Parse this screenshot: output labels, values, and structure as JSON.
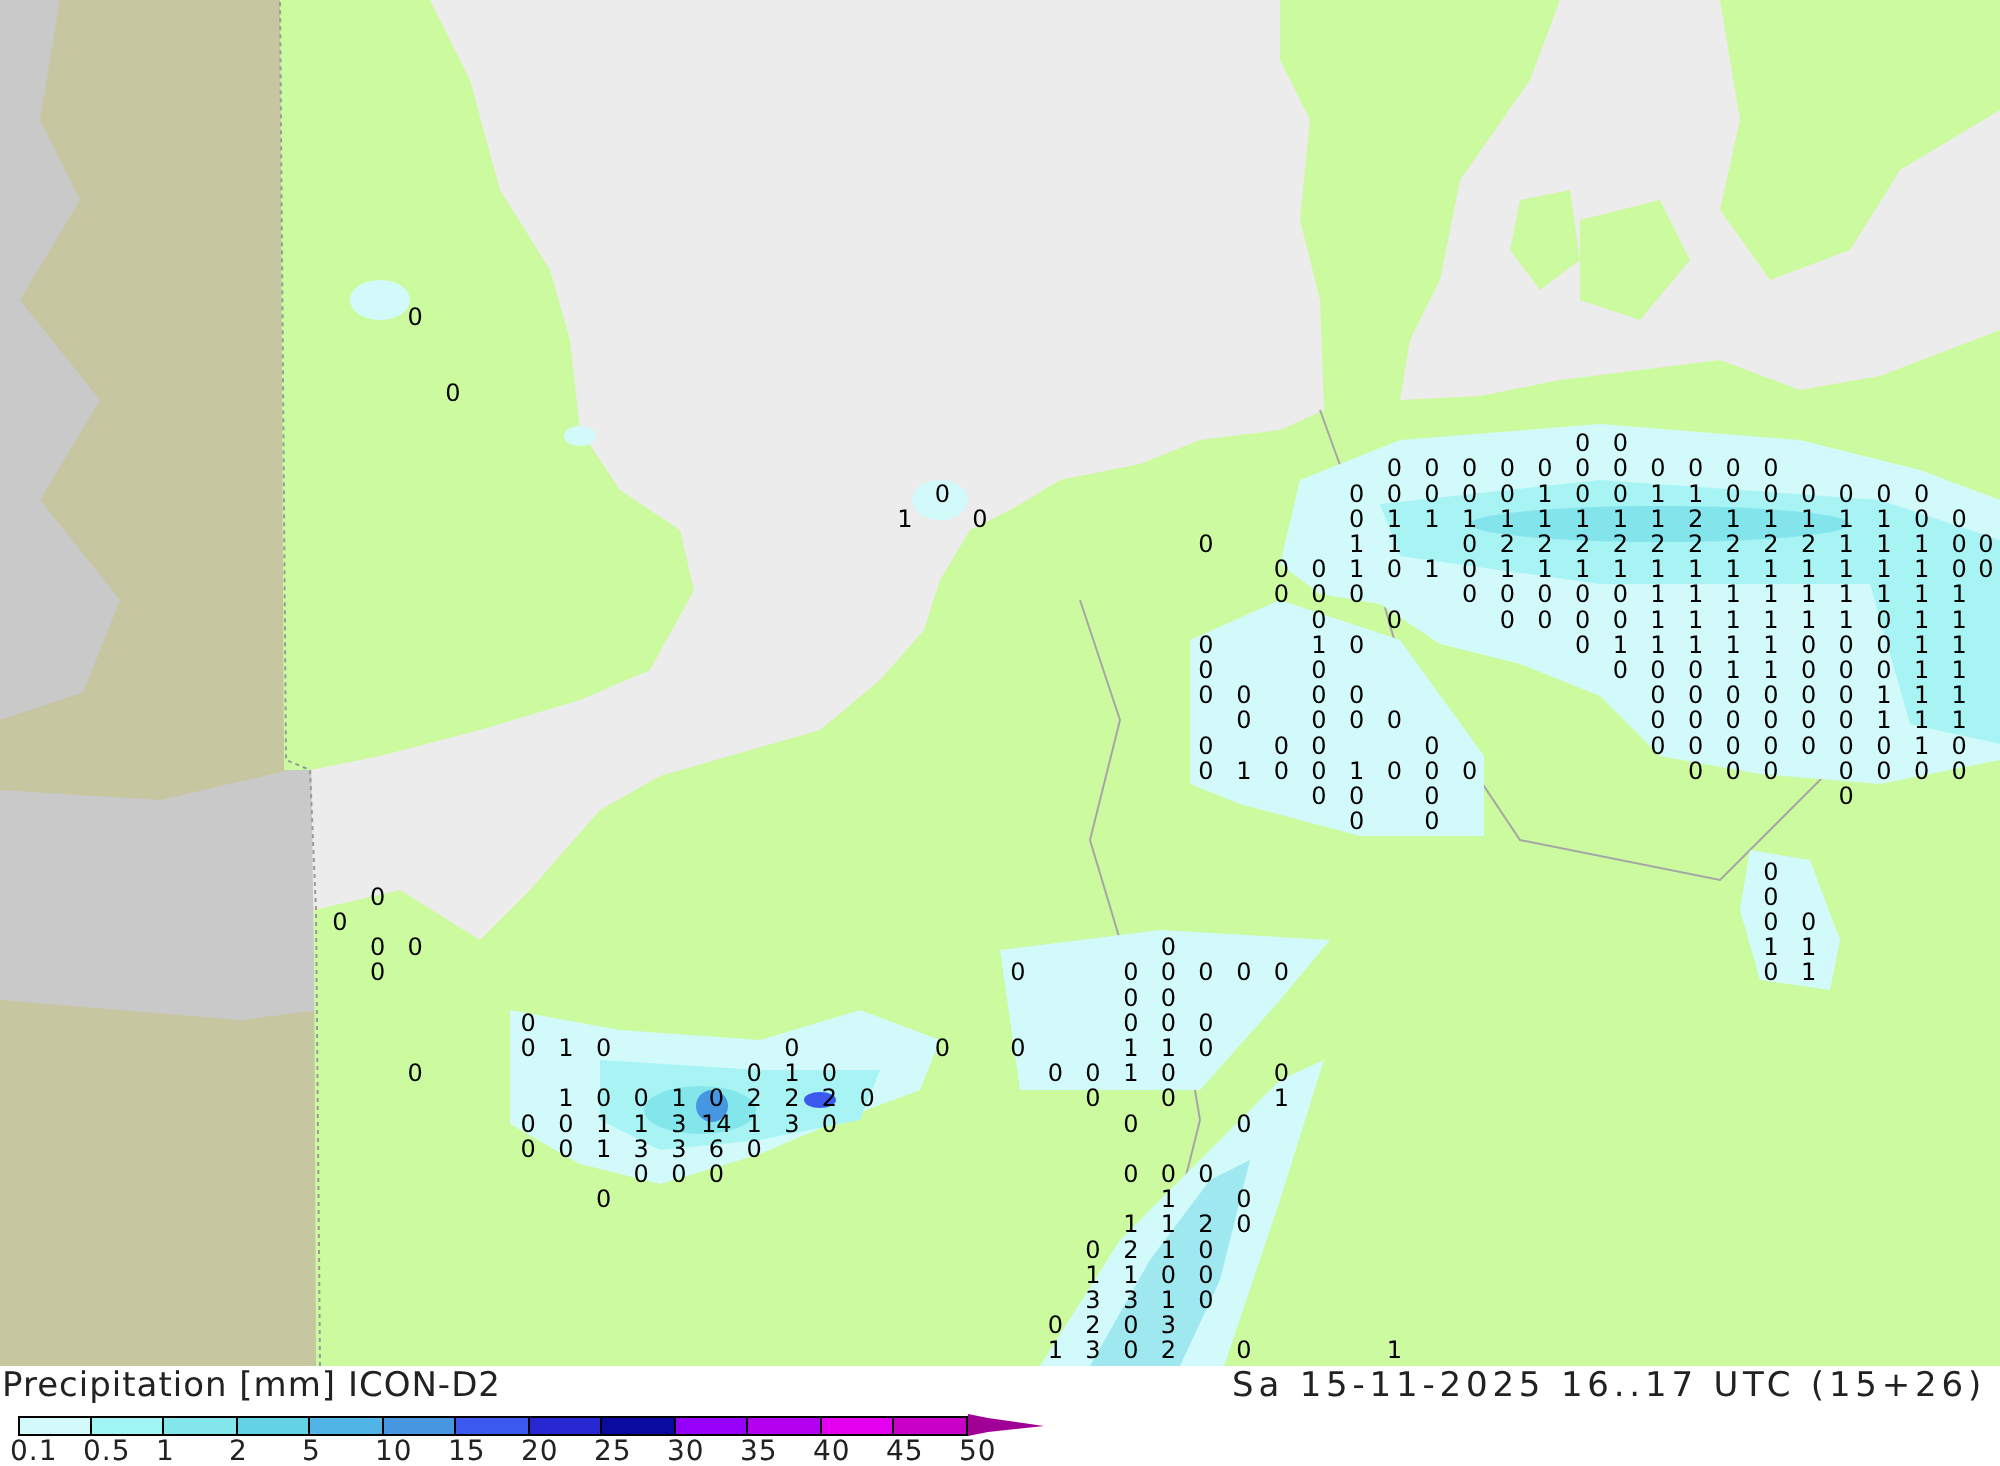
{
  "map": {
    "value_labels": [
      "0",
      "0",
      "0",
      "0",
      "0",
      "0",
      "0",
      "0",
      "0",
      "0",
      "0",
      "0",
      "0",
      "0",
      "0",
      "0",
      "0",
      "0",
      "0",
      "0",
      "0",
      "1",
      "0",
      "0",
      "1",
      "1",
      "0",
      "0",
      "0",
      "0",
      "0",
      "0",
      "1",
      "0",
      "0",
      "1",
      "1",
      "1",
      "1",
      "1",
      "1",
      "1",
      "1",
      "2",
      "1",
      "1",
      "1",
      "1",
      "1",
      "0",
      "0",
      "0",
      "1",
      "1",
      "0",
      "2",
      "2",
      "2",
      "2",
      "2",
      "2",
      "2",
      "2",
      "2",
      "1",
      "1",
      "1",
      "0",
      "0",
      "0",
      "0",
      "1",
      "0",
      "1",
      "0",
      "1",
      "1",
      "1",
      "1",
      "1",
      "1",
      "1",
      "1",
      "1",
      "1",
      "1",
      "1",
      "0",
      "0",
      "0",
      "0",
      "0",
      "0",
      "0",
      "0",
      "0",
      "0",
      "1",
      "1",
      "1",
      "1",
      "1",
      "1",
      "1",
      "1",
      "1",
      "0",
      "0",
      "0",
      "0",
      "0",
      "0",
      "1",
      "1",
      "1",
      "1",
      "1",
      "1",
      "0",
      "1",
      "1",
      "0",
      "1",
      "0",
      "0",
      "1",
      "1",
      "1",
      "1",
      "1",
      "0",
      "0",
      "0",
      "1",
      "1",
      "0",
      "0",
      "0",
      "0",
      "0",
      "1",
      "1",
      "0",
      "0",
      "0",
      "1",
      "1",
      "0",
      "0",
      "0",
      "0",
      "0",
      "0",
      "0",
      "0",
      "0",
      "0",
      "1",
      "1",
      "1",
      "0",
      "0",
      "0",
      "0",
      "0",
      "0",
      "0",
      "0",
      "0",
      "0",
      "1",
      "1",
      "1",
      "0",
      "0",
      "0",
      "0",
      "0",
      "0",
      "0",
      "0",
      "0",
      "0",
      "0",
      "1",
      "0",
      "0",
      "1",
      "0",
      "0",
      "1",
      "0",
      "0",
      "0",
      "0",
      "0",
      "0",
      "0",
      "0",
      "0",
      "0",
      "0",
      "0",
      "0",
      "0",
      "0",
      "0",
      "0",
      "0",
      "0",
      "0",
      "0",
      "0",
      "0",
      "0",
      "0",
      "1",
      "1",
      "0",
      "0",
      "0",
      "0",
      "0",
      "0",
      "0",
      "0",
      "1",
      "0",
      "0",
      "0",
      "0",
      "0",
      "0",
      "0",
      "1",
      "0",
      "0",
      "0",
      "0",
      "1",
      "1",
      "0",
      "0",
      "0",
      "1",
      "0",
      "0",
      "0",
      "1",
      "0",
      "0",
      "1",
      "0",
      "0",
      "1",
      "0",
      "2",
      "2",
      "2",
      "0",
      "0",
      "0",
      "1",
      "0",
      "0",
      "1",
      "1",
      "3",
      "14",
      "1",
      "3",
      "0",
      "0",
      "0",
      "0",
      "0",
      "1",
      "3",
      "3",
      "6",
      "0",
      "0",
      "0",
      "0",
      "0",
      "0",
      "0",
      "0",
      "1",
      "0",
      "1",
      "1",
      "2",
      "0",
      "0",
      "2",
      "1",
      "0",
      "1",
      "1",
      "0",
      "0",
      "3",
      "3",
      "1",
      "0",
      "0",
      "2",
      "0",
      "3",
      "1",
      "3",
      "0",
      "2",
      "0",
      "1"
    ]
  },
  "legend": {
    "title": "Precipitation [mm] ICON-D2",
    "timestamp": "Sa 15-11-2025 16..17 UTC (15+26)",
    "bins": [
      {
        "color": "#d2fafa"
      },
      {
        "color": "#a0f5f5"
      },
      {
        "color": "#82e6eb"
      },
      {
        "color": "#64d2e6"
      },
      {
        "color": "#50b4e6"
      },
      {
        "color": "#4696e1"
      },
      {
        "color": "#3c5af0"
      },
      {
        "color": "#2828d2"
      },
      {
        "color": "#0a0aa0"
      },
      {
        "color": "#9600fa"
      },
      {
        "color": "#b400f0"
      },
      {
        "color": "#e600f0"
      },
      {
        "color": "#c800c8"
      }
    ],
    "overflow": {
      "color": "#a00096"
    },
    "ticks": [
      "0.1",
      "0.5",
      "1",
      "2",
      "5",
      "10",
      "15",
      "20",
      "25",
      "30",
      "35",
      "40",
      "45",
      "50"
    ]
  }
}
